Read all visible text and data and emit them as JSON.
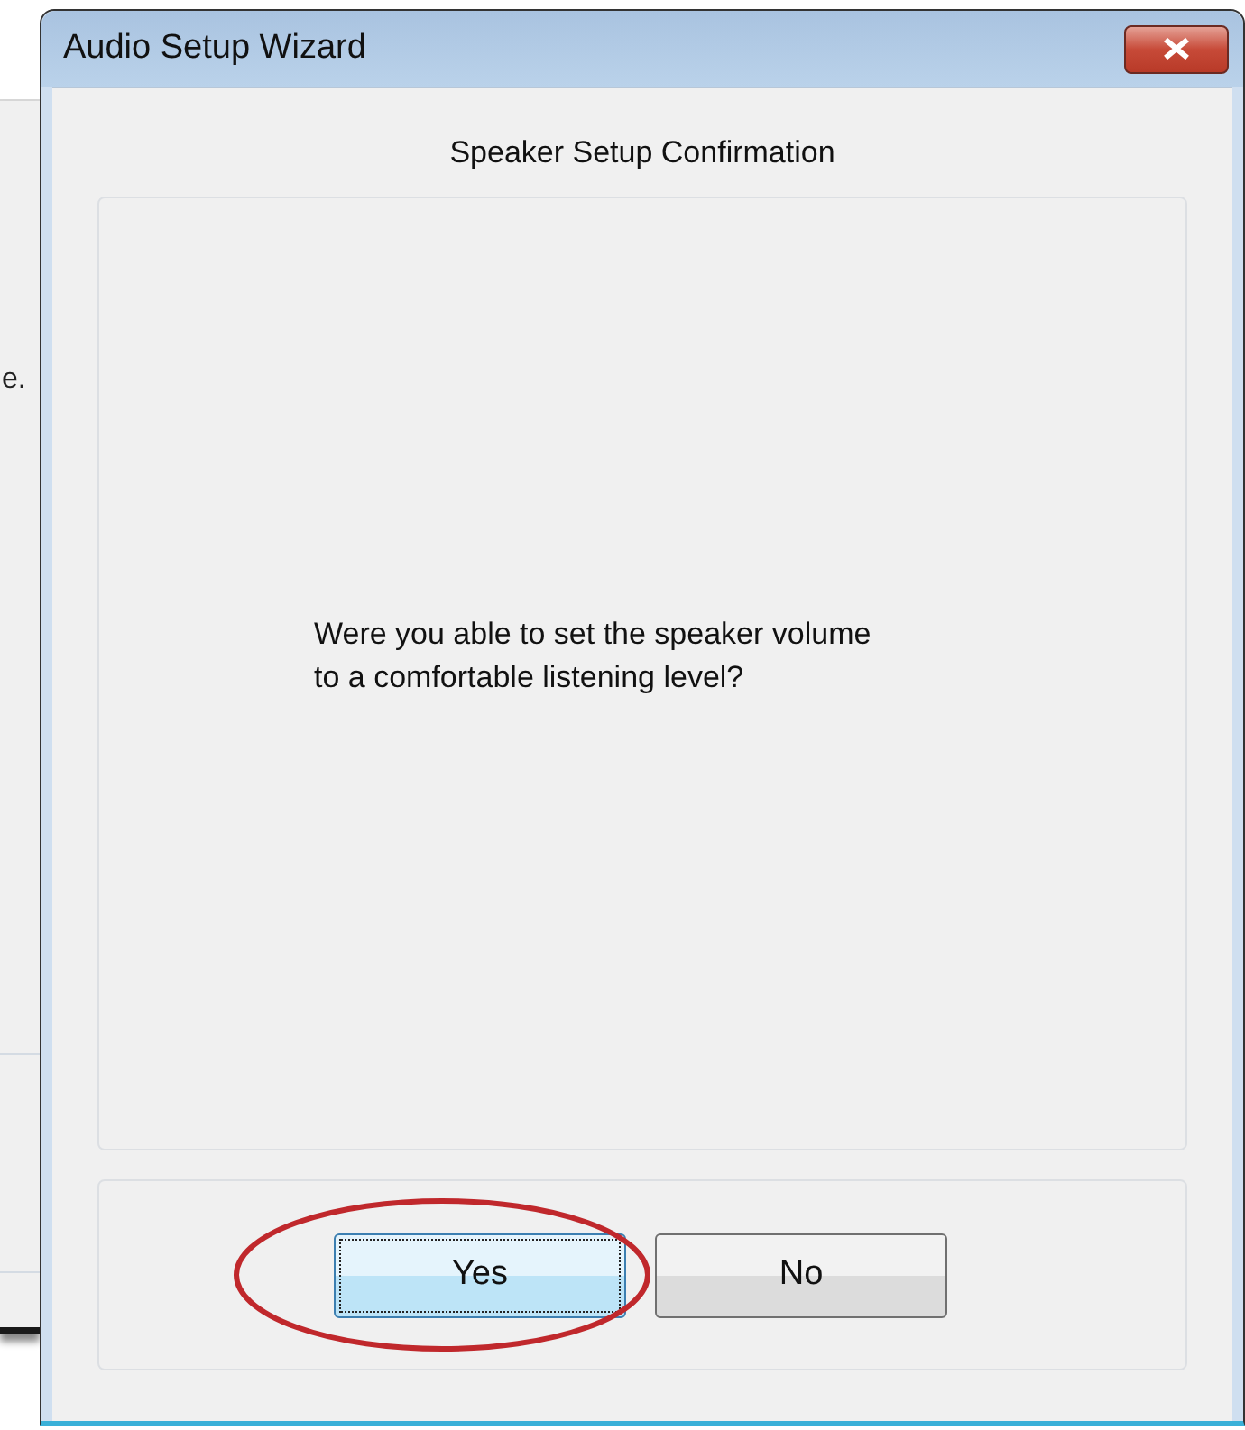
{
  "background_window": {
    "text": "e."
  },
  "window": {
    "title": "Audio Setup Wizard"
  },
  "heading": "Speaker Setup Confirmation",
  "message": "Were you able to set the speaker volume\nto a comfortable listening level?",
  "buttons": [
    {
      "label": "Yes",
      "selected": true
    },
    {
      "label": "No",
      "selected": false
    }
  ]
}
